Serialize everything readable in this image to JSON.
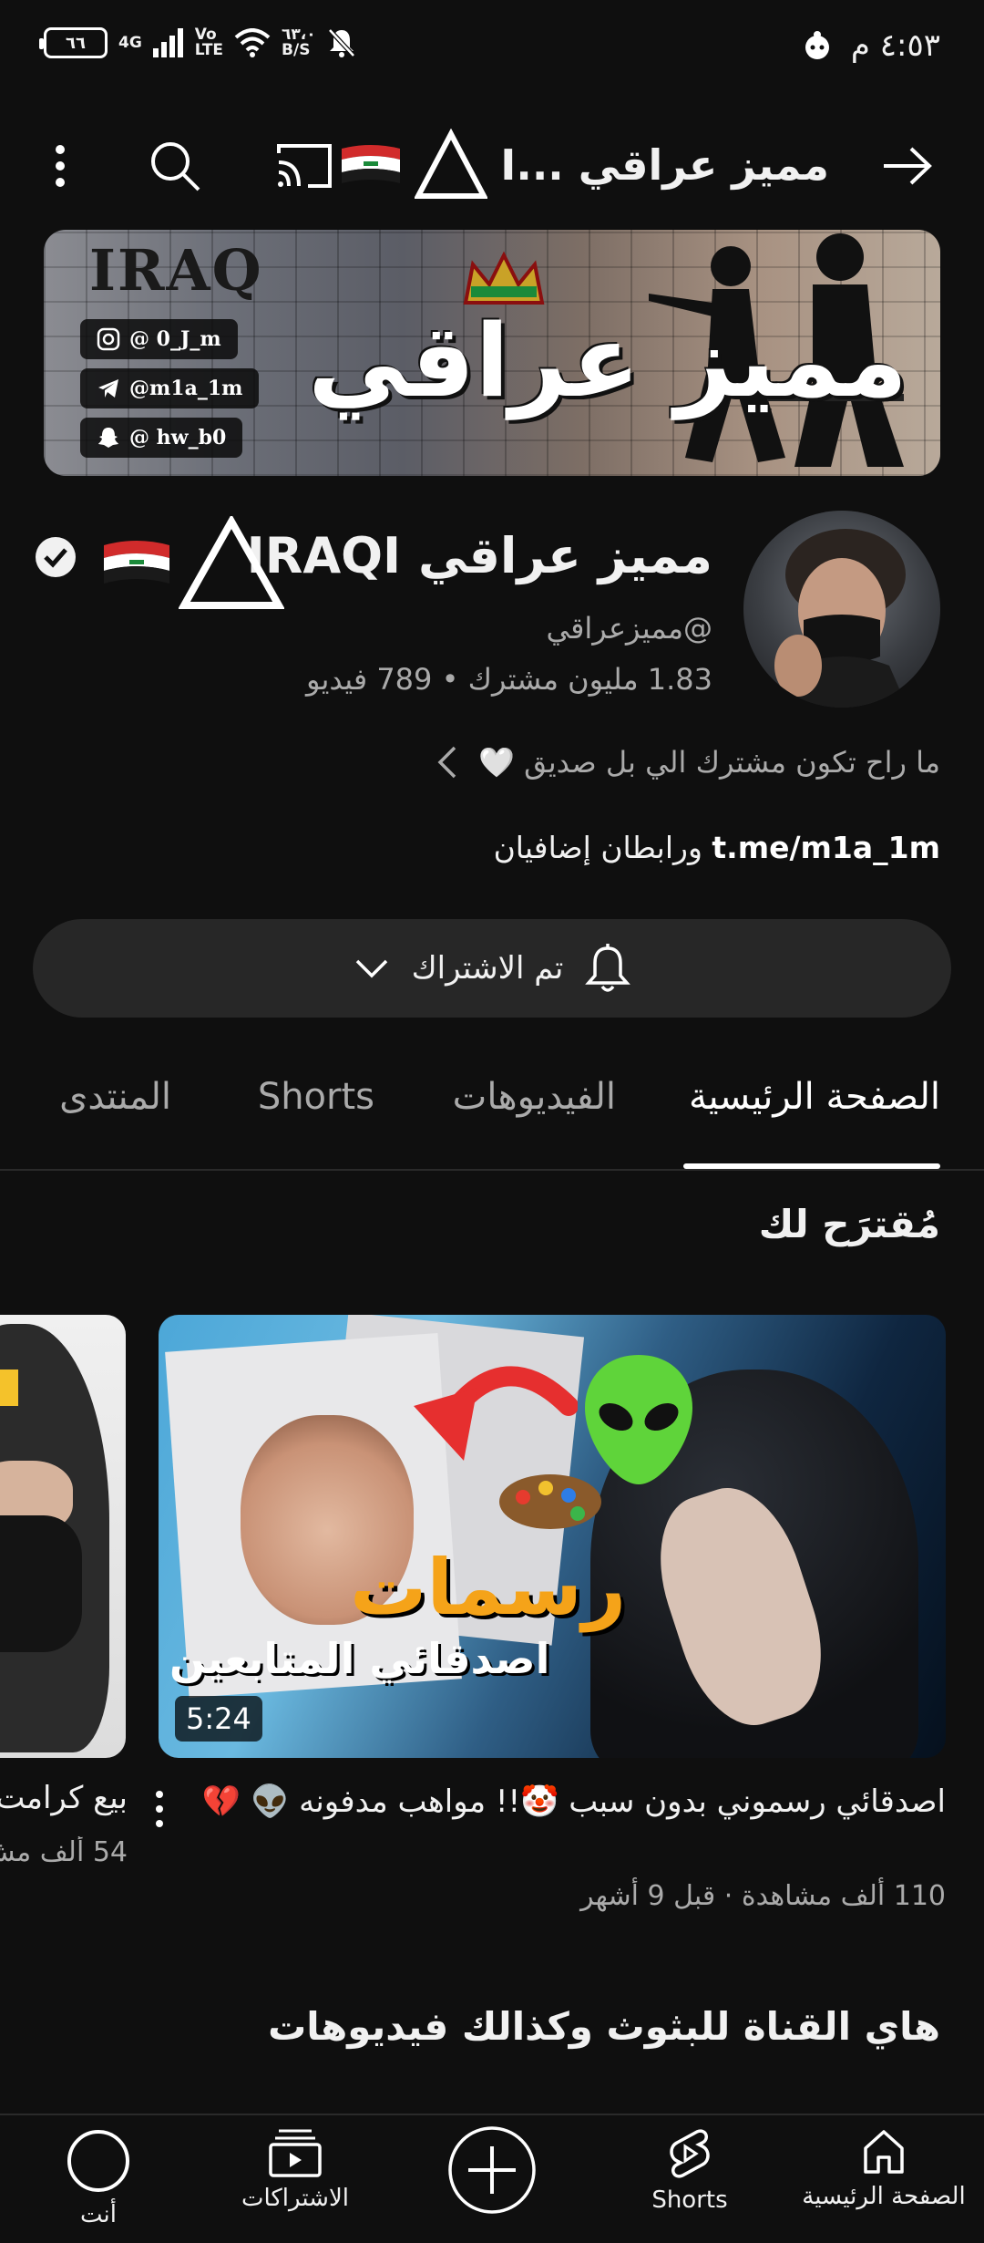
{
  "status_bar": {
    "battery": "٦٦",
    "network": "4G",
    "volte_top": "Vo",
    "volte_bottom": "LTE",
    "speed_top": "٦٣،٠",
    "speed_bottom": "B/S",
    "time": "٤:٥٣ م"
  },
  "top_bar": {
    "title": "مميز عراقي ...I"
  },
  "banner": {
    "raq_text": "IRAQ",
    "title": "مميز عراقي",
    "tags": [
      "@ 0_J_m",
      "@m1a_1m",
      "@ hw_b0"
    ]
  },
  "channel": {
    "name": "مميز عراقي IRAQI",
    "handle": "@مميزعراقي",
    "stats": "1.83 مليون مشترك • 789 فيديو",
    "description": "ما راح تكون مشترك الي بل صديق 🤍",
    "link": "t.me/m1a_1m",
    "link_suffix": " ورابطان إضافيان"
  },
  "subscribe_button": {
    "label": "تم الاشتراك"
  },
  "tabs": [
    {
      "label": "الصفحة الرئيسية",
      "active": true
    },
    {
      "label": "الفيديوهات",
      "active": false
    },
    {
      "label": "Shorts",
      "active": false
    },
    {
      "label": "المنتدى",
      "active": false
    }
  ],
  "section": {
    "title": "مُقترَح لك"
  },
  "video": {
    "thumb_text_main": "رسمات",
    "thumb_text_sub": "اصدقائي المتابعين",
    "duration": "5:24",
    "title": "اصدقائي رسموني بدون سبب 🤡!! مواهب مدفونه 👽 💔",
    "meta": "110 ألف مشاهدة · قبل 9 أشهر"
  },
  "video2": {
    "title": "بيع كرامت",
    "meta": "54 ألف مش"
  },
  "section2": {
    "title": "هاي القناة للبثوث وكذالك فيديوهات"
  },
  "bottom_nav": [
    {
      "label": "الصفحة الرئيسية"
    },
    {
      "label": "Shorts"
    },
    {
      "label": ""
    },
    {
      "label": "الاشتراكات"
    },
    {
      "label": "أنت"
    }
  ],
  "colors": {
    "background": "#0f0f0f",
    "surface": "#272727",
    "text_primary": "#f1f1f1",
    "text_secondary": "#aaaaaa"
  }
}
